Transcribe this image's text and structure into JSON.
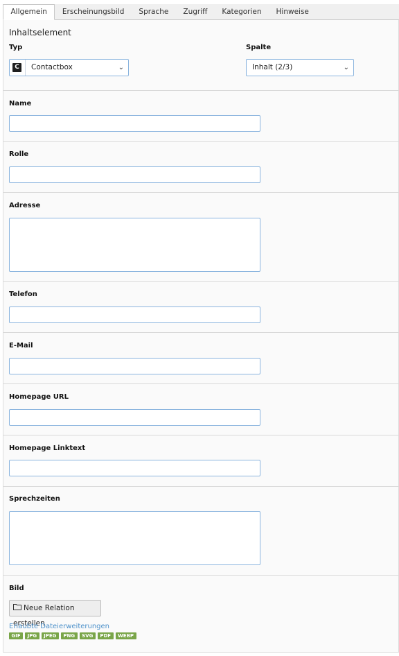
{
  "tabs": [
    "Allgemein",
    "Erscheinungsbild",
    "Sprache",
    "Zugriff",
    "Kategorien",
    "Hinweise"
  ],
  "section_title": "Inhaltselement",
  "typ": {
    "label": "Typ",
    "icon_letter": "C",
    "value": "Contactbox"
  },
  "spalte": {
    "label": "Spalte",
    "value": "Inhalt (2/3)"
  },
  "fields": {
    "name": "Name",
    "rolle": "Rolle",
    "adresse": "Adresse",
    "telefon": "Telefon",
    "email": "E-Mail",
    "homepage_url": "Homepage URL",
    "homepage_linktext": "Homepage Linktext",
    "sprechzeiten": "Sprechzeiten",
    "bild": "Bild"
  },
  "relation_button": "Neue Relation erstellen",
  "allowed_extensions_label": "Erlaubte Dateierweiterungen",
  "extensions": [
    "GIF",
    "JPG",
    "JPEG",
    "PNG",
    "SVG",
    "PDF",
    "WEBP"
  ]
}
